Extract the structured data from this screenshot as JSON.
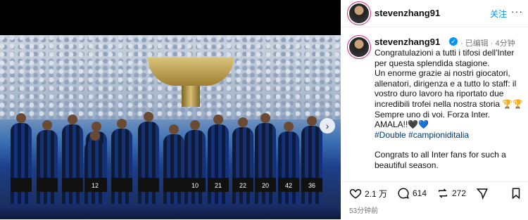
{
  "header": {
    "username": "stevenzhang91",
    "follow_label": "关注",
    "more": "···"
  },
  "post": {
    "username": "stevenzhang91",
    "verified_mark": "✓",
    "edited_label": "· 已编辑",
    "age": "· 4分钟",
    "caption_lines": [
      "Congratulazioni a tutti i tifosi dell'Inter per questa splendida stagione.",
      "Un enorme grazie ai nostri giocatori, allenatori, dirigenza e a tutto lo staff: il vostro duro lavoro ha riportato due incredibili trofei nella nostra storia 🏆🏆",
      "Sempre uno di voi. Forza Inter.",
      "AMALA!!🖤💙"
    ],
    "hashtags": "#Double #campioniditalia",
    "english_lead": "Congrats to all Inter fans for such a beautiful season."
  },
  "stats": {
    "likes": "2.1 万",
    "comments": "614",
    "reposts": "272"
  },
  "timestamp": "53分钟前",
  "photo": {
    "jersey_numbers": [
      "10",
      "21",
      "22",
      "20",
      "42",
      "36",
      "12"
    ],
    "next_icon": "chevron-right-icon"
  }
}
